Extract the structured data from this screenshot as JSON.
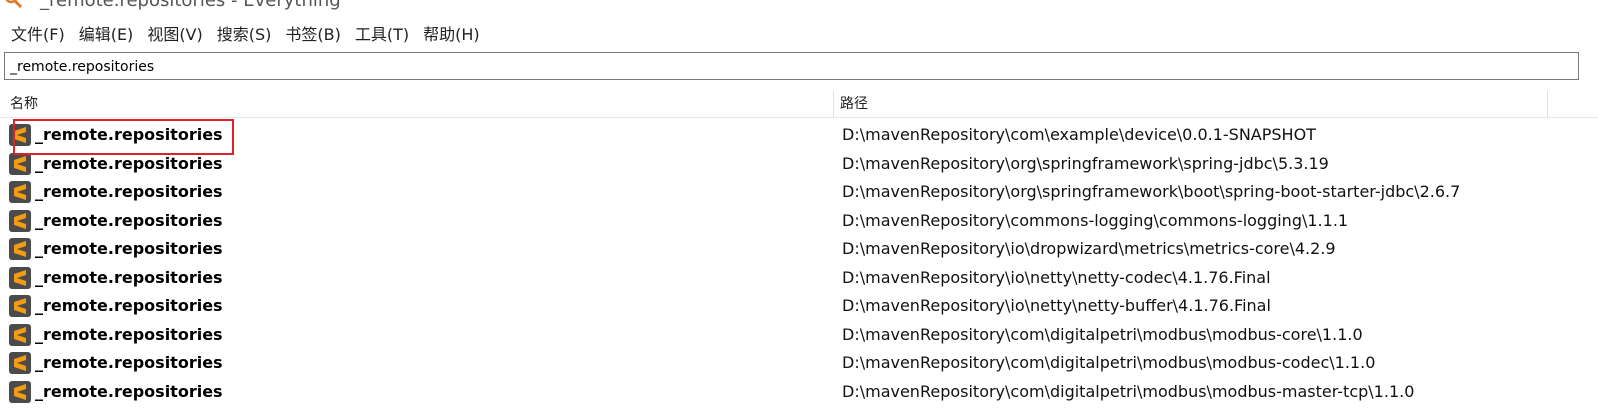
{
  "window": {
    "title": "_remote.repositories - Everything",
    "app_icon": "magnifier-icon"
  },
  "menu": [
    {
      "label": "文件(F)"
    },
    {
      "label": "编辑(E)"
    },
    {
      "label": "视图(V)"
    },
    {
      "label": "搜索(S)"
    },
    {
      "label": "书签(B)"
    },
    {
      "label": "工具(T)"
    },
    {
      "label": "帮助(H)"
    }
  ],
  "search": {
    "value": "_remote.repositories"
  },
  "columns": {
    "name": "名称",
    "path": "路径"
  },
  "results": [
    {
      "name": "_remote.repositories",
      "path": "D:\\mavenRepository\\com\\example\\device\\0.0.1-SNAPSHOT",
      "icon": "sublime-text-file-icon"
    },
    {
      "name": "_remote.repositories",
      "path": "D:\\mavenRepository\\org\\springframework\\spring-jdbc\\5.3.19",
      "icon": "sublime-text-file-icon"
    },
    {
      "name": "_remote.repositories",
      "path": "D:\\mavenRepository\\org\\springframework\\boot\\spring-boot-starter-jdbc\\2.6.7",
      "icon": "sublime-text-file-icon"
    },
    {
      "name": "_remote.repositories",
      "path": "D:\\mavenRepository\\commons-logging\\commons-logging\\1.1.1",
      "icon": "sublime-text-file-icon"
    },
    {
      "name": "_remote.repositories",
      "path": "D:\\mavenRepository\\io\\dropwizard\\metrics\\metrics-core\\4.2.9",
      "icon": "sublime-text-file-icon"
    },
    {
      "name": "_remote.repositories",
      "path": "D:\\mavenRepository\\io\\netty\\netty-codec\\4.1.76.Final",
      "icon": "sublime-text-file-icon"
    },
    {
      "name": "_remote.repositories",
      "path": "D:\\mavenRepository\\io\\netty\\netty-buffer\\4.1.76.Final",
      "icon": "sublime-text-file-icon"
    },
    {
      "name": "_remote.repositories",
      "path": "D:\\mavenRepository\\com\\digitalpetri\\modbus\\modbus-core\\1.1.0",
      "icon": "sublime-text-file-icon"
    },
    {
      "name": "_remote.repositories",
      "path": "D:\\mavenRepository\\com\\digitalpetri\\modbus\\modbus-codec\\1.1.0",
      "icon": "sublime-text-file-icon"
    },
    {
      "name": "_remote.repositories",
      "path": "D:\\mavenRepository\\com\\digitalpetri\\modbus\\modbus-master-tcp\\1.1.0",
      "icon": "sublime-text-file-icon"
    }
  ],
  "highlight": {
    "color": "#e0202c"
  },
  "colors": {
    "icon_bg": "#4b4b4b",
    "icon_accent": "#f39c12"
  }
}
